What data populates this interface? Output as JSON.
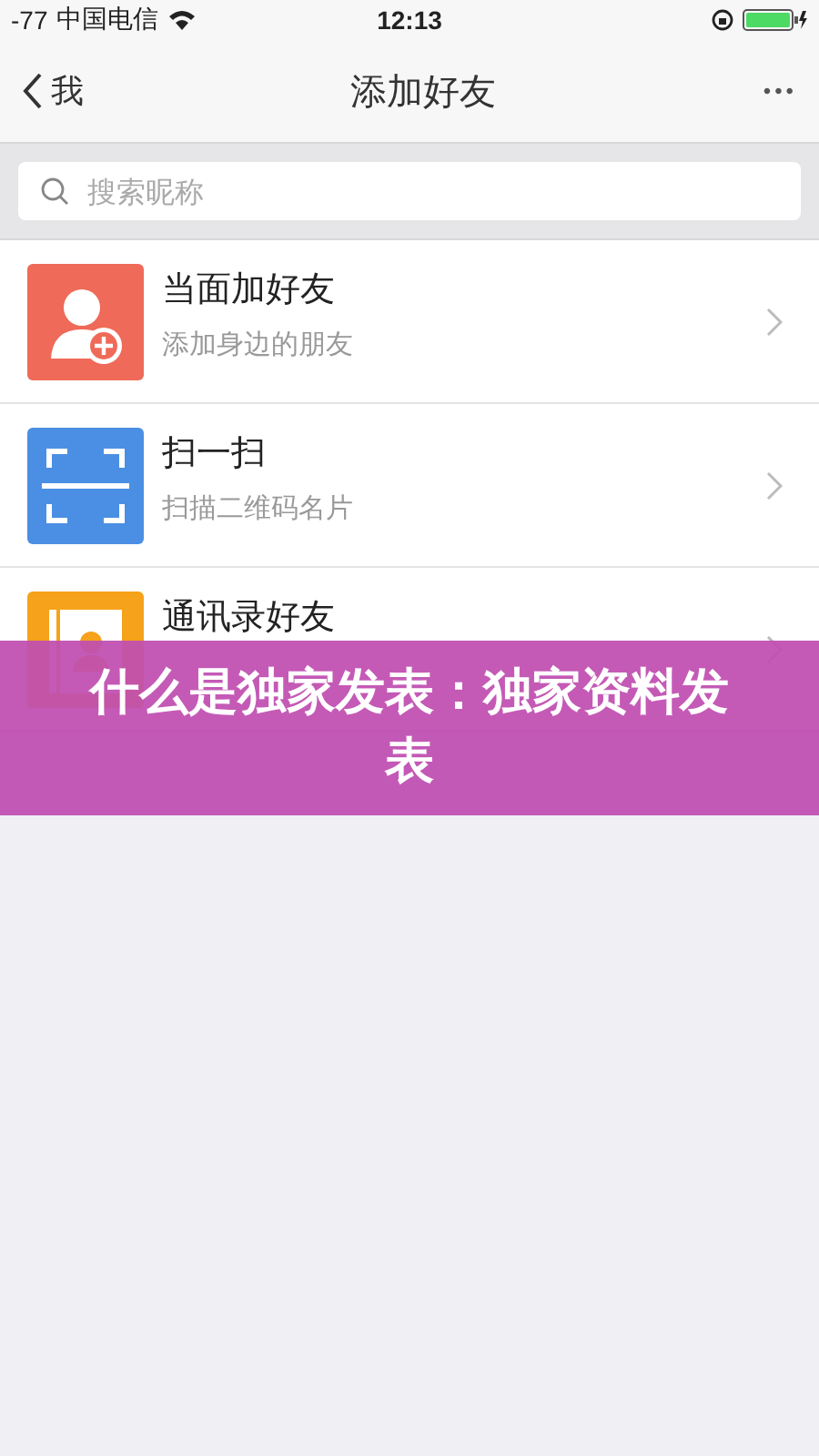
{
  "status_bar": {
    "signal": "-77",
    "carrier": "中国电信",
    "time": "12:13"
  },
  "nav": {
    "back": "我",
    "title": "添加好友",
    "more": "•••"
  },
  "search": {
    "placeholder": "搜索昵称"
  },
  "items": [
    {
      "kind": "person-add",
      "color": "#ef6a58",
      "title": "当面加好友",
      "subtitle": "添加身边的朋友"
    },
    {
      "kind": "scan",
      "color": "#4a8fe3",
      "title": "扫一扫",
      "subtitle": "扫描二维码名片"
    },
    {
      "kind": "contacts",
      "color": "#f6a21b",
      "title": "通讯录好友"
    }
  ],
  "banner": {
    "title": "什么是独家发表：独家资料发表"
  }
}
